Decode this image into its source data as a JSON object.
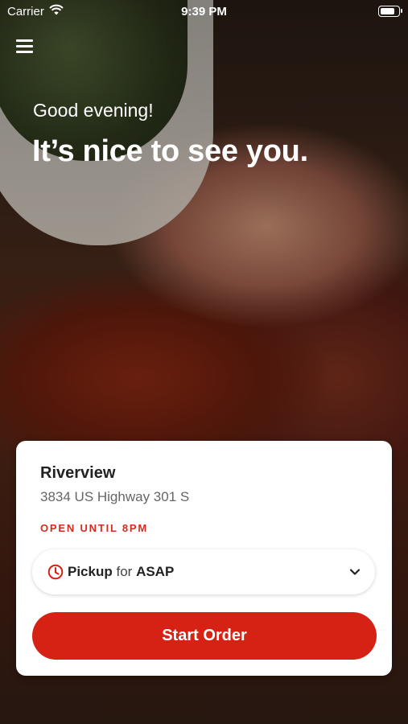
{
  "status_bar": {
    "carrier": "Carrier",
    "time": "9:39 PM",
    "wifi_icon": "wifi-icon",
    "battery_icon": "battery-icon"
  },
  "header": {
    "menu_icon": "hamburger-menu-icon",
    "greeting": "Good evening!",
    "headline": "It’s nice to see you."
  },
  "location": {
    "name": "Riverview",
    "address": "3834 US Highway 301 S",
    "hours": "OPEN UNTIL 8PM"
  },
  "order_mode": {
    "clock_icon": "clock-icon",
    "type": "Pickup",
    "connector": "for",
    "timing": "ASAP",
    "chevron_icon": "chevron-down-icon"
  },
  "actions": {
    "start_order": "Start Order"
  },
  "colors": {
    "accent": "#d62214",
    "hours_text": "#d52b1e"
  }
}
